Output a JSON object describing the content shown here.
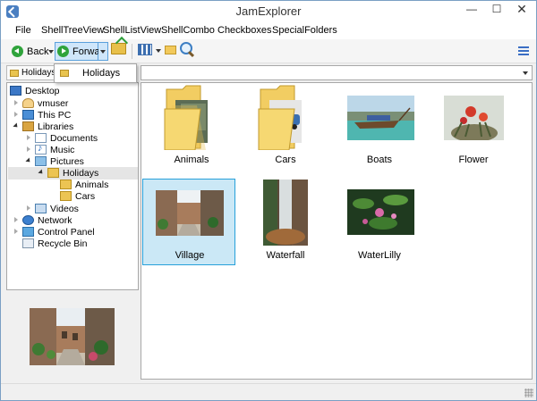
{
  "window": {
    "title": "JamExplorer"
  },
  "menu": [
    "File",
    "ShellTreeView",
    "ShellListView",
    "ShellCombo",
    "Checkboxes",
    "SpecialFolders"
  ],
  "toolbar": {
    "back_label": "Back",
    "forward_label": "Forward"
  },
  "address": {
    "crumb": "Holidays",
    "dropdown_item": "Holidays"
  },
  "tree": [
    {
      "label": "Desktop",
      "icon": "desktop-icon"
    },
    {
      "label": "vmuser",
      "icon": "user-folder-icon"
    },
    {
      "label": "This PC",
      "icon": "this-pc-icon"
    },
    {
      "label": "Libraries",
      "icon": "libraries-icon"
    },
    {
      "label": "Documents",
      "icon": "documents-icon"
    },
    {
      "label": "Music",
      "icon": "music-icon"
    },
    {
      "label": "Pictures",
      "icon": "pictures-icon"
    },
    {
      "label": "Holidays",
      "icon": "folder-icon"
    },
    {
      "label": "Animals",
      "icon": "folder-icon"
    },
    {
      "label": "Cars",
      "icon": "folder-icon"
    },
    {
      "label": "Videos",
      "icon": "videos-icon"
    },
    {
      "label": "Network",
      "icon": "network-icon"
    },
    {
      "label": "Control Panel",
      "icon": "control-panel-icon"
    },
    {
      "label": "Recycle Bin",
      "icon": "recycle-bin-icon"
    }
  ],
  "files": [
    {
      "name": "Animals",
      "kind": "folder"
    },
    {
      "name": "Cars",
      "kind": "folder"
    },
    {
      "name": "Boats",
      "kind": "image"
    },
    {
      "name": "Flower",
      "kind": "image"
    },
    {
      "name": "Village",
      "kind": "image",
      "selected": true
    },
    {
      "name": "Waterfall",
      "kind": "image"
    },
    {
      "name": "WaterLilly",
      "kind": "image"
    }
  ],
  "colors": {
    "selection": "#cbe8f6",
    "selection_border": "#26a0da",
    "accent": "#2fa33b"
  }
}
